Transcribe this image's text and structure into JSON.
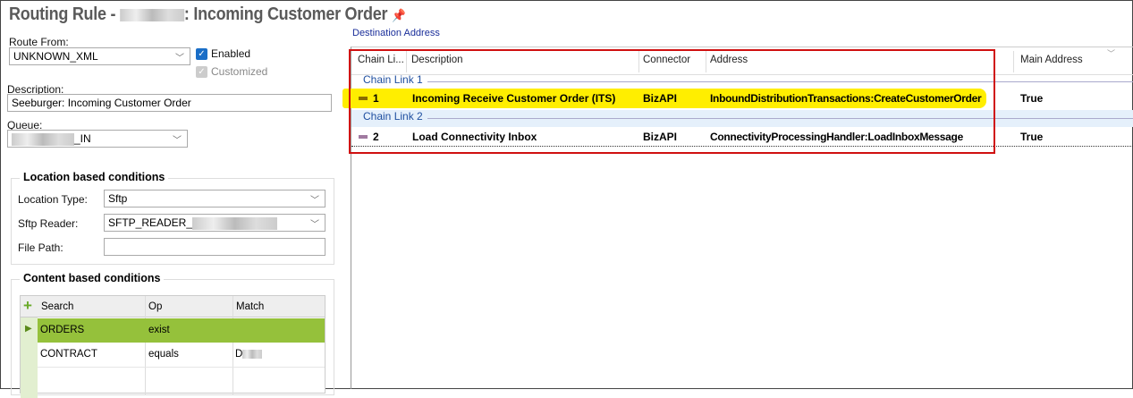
{
  "title": {
    "prefix": "Routing Rule - ",
    "suffix": ": Incoming Customer Order",
    "pin_icon": "pin-icon"
  },
  "left": {
    "route_from_label": "Route From:",
    "route_from_value": "UNKNOWN_XML",
    "enabled_label": "Enabled",
    "enabled_checked": true,
    "customized_label": "Customized",
    "customized_checked": true,
    "description_label": "Description:",
    "description_value": "Seeburger: Incoming Customer Order",
    "queue_label": "Queue:",
    "queue_value_suffix": "_IN",
    "location_group": {
      "title": "Location based conditions",
      "location_type_label": "Location Type:",
      "location_type_value": "Sftp",
      "sftp_reader_label": "Sftp Reader:",
      "sftp_reader_value": "SFTP_READER_",
      "file_path_label": "File Path:",
      "file_path_value": ""
    },
    "content_group": {
      "title": "Content based conditions",
      "columns": [
        "Search",
        "Op",
        "Match"
      ],
      "rows": [
        {
          "search": "ORDERS",
          "op": "exist",
          "match": ""
        },
        {
          "search": "CONTRACT",
          "op": "equals",
          "match": "D"
        }
      ]
    }
  },
  "destination": {
    "label": "Destination Address",
    "columns": [
      "Chain Li...",
      "Description",
      "Connector",
      "Address",
      "Main Address"
    ],
    "groups": [
      {
        "label": "Chain Link 1",
        "rows": [
          {
            "link": "1",
            "description": "Incoming Receive Customer Order (ITS)",
            "connector": "BizAPI",
            "address": "InboundDistributionTransactions:CreateCustomerOrder",
            "main": "True",
            "color": "#8a6d00"
          }
        ]
      },
      {
        "label": "Chain Link 2",
        "rows": [
          {
            "link": "2",
            "description": "Load Connectivity Inbox",
            "connector": "BizAPI",
            "address": "ConnectivityProcessingHandler:LoadInboxMessage",
            "main": "True",
            "color": "#a07aa0"
          }
        ]
      }
    ],
    "highlight_color": "#ffee00",
    "annotation_color": "#d01010"
  }
}
